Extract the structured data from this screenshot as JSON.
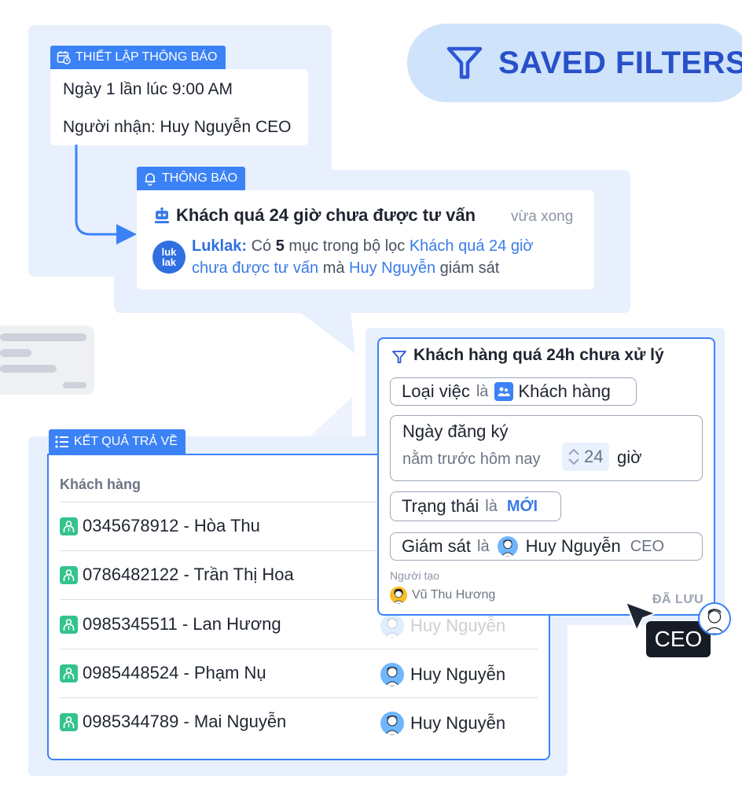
{
  "saved_filters": {
    "label": "SAVED FILTERS"
  },
  "settings": {
    "tag": "THIẾT LẬP THÔNG BÁO",
    "schedule": "Ngày 1 lần lúc 9:00 AM",
    "recipient": "Người nhận: Huy Nguyễn CEO"
  },
  "notification": {
    "tag": "THÔNG BÁO",
    "title": "Khách quá 24 giờ chưa được tư vấn",
    "time": "vừa xong",
    "logo_line1": "luk",
    "logo_line2": "lak",
    "sender": "Luklak:",
    "text_1": "Có",
    "count": "5",
    "text_2": "mục trong bộ lọc",
    "filter_name_1": "Khách quá 24 giờ",
    "filter_name_2": "chưa được tư vấn",
    "text_3": "mà",
    "person": "Huy Nguyễn",
    "text_4": "giám sát"
  },
  "filter_card": {
    "title": "Khách hàng quá 24h chưa xử lý",
    "conditions": {
      "type_field": "Loại việc",
      "type_op": "là",
      "type_value": "Khách hàng",
      "date_field": "Ngày đăng ký",
      "date_desc": "nằm trước hôm nay",
      "date_value": "24",
      "date_unit": "giờ",
      "status_field": "Trạng thái",
      "status_op": "là",
      "status_value": "MỚI",
      "supervisor_field": "Giám sát",
      "supervisor_op": "là",
      "supervisor_name": "Huy Nguyễn",
      "supervisor_role": "CEO"
    },
    "creator_label": "Người tạo",
    "creator_name": "Vũ Thu Hương",
    "saved": "ĐÃ LƯU"
  },
  "cursor_badge": "CEO",
  "results": {
    "tag": "KẾT QUẢ TRẢ VỀ",
    "column_header": "Khách hàng",
    "rows": [
      {
        "customer": "0345678912 - Hòa Thu",
        "supervisor": ""
      },
      {
        "customer": "0786482122 - Trần Thị Hoa",
        "supervisor": ""
      },
      {
        "customer": "0985345511 - Lan Hương",
        "supervisor": "Huy Nguyễn"
      },
      {
        "customer": "0985448524 - Phạm Nụ",
        "supervisor": "Huy Nguyễn"
      },
      {
        "customer": "0985344789 - Mai Nguyễn",
        "supervisor": "Huy Nguyễn"
      }
    ]
  },
  "colors": {
    "accent": "#3b82f6",
    "panel": "#e8f0fd",
    "status_green": "#34c38f",
    "pill": "#cfe3fb"
  },
  "icons": [
    "calendar-clock-icon",
    "bell-icon",
    "robot-icon",
    "funnel-icon",
    "list-icon",
    "person-badge-icon",
    "cursor-arrow-icon",
    "avatar"
  ]
}
